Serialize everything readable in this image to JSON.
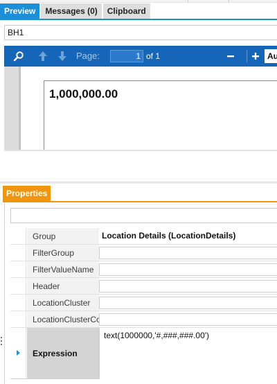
{
  "tabs": [
    {
      "label": "Preview",
      "active": true
    },
    {
      "label": "Messages (0)",
      "active": false
    },
    {
      "label": "Clipboard",
      "active": false
    }
  ],
  "preview": {
    "field_value": "BH1",
    "toolbar": {
      "page_label": "Page:",
      "page_number": "1",
      "of_label": "of 1",
      "zoom_label": "Au",
      "icons": [
        "search-icon",
        "arrow-up-icon",
        "arrow-down-icon",
        "zoom-out-icon",
        "zoom-in-icon"
      ]
    },
    "rendered_value": "1,000,000.00"
  },
  "properties": {
    "tab_label": "Properties",
    "search_value": "",
    "rows": [
      {
        "name": "Group",
        "value": "Location Details (LocationDetails)"
      },
      {
        "name": "FilterGroup",
        "value": ""
      },
      {
        "name": "FilterValueName",
        "value": ""
      },
      {
        "name": "Header",
        "value": ""
      },
      {
        "name": "LocationCluster",
        "value": ""
      },
      {
        "name": "LocationClusterCo",
        "value": ""
      }
    ],
    "expression": {
      "name": "Expression",
      "value": "text(1000000,'#,###,###.00')"
    }
  },
  "colors": {
    "accent_blue": "#1c8fd8",
    "toolbar_blue": "#1565b8",
    "properties_orange": "#f0960e"
  }
}
